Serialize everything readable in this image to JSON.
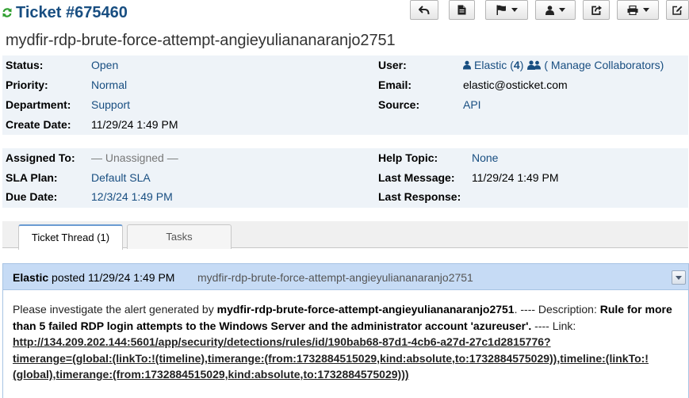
{
  "header": {
    "ticket_number": "Ticket #675460",
    "subject": "mydfir-rdp-brute-force-attempt-angieyuliananaranjo2751"
  },
  "toolbar": {
    "icons": [
      "reply-icon",
      "note-icon",
      "flag-icon",
      "user-icon",
      "share-icon",
      "print-icon",
      "edit-icon"
    ]
  },
  "info": {
    "status_label": "Status:",
    "status_value": "Open",
    "priority_label": "Priority:",
    "priority_value": "Normal",
    "department_label": "Department:",
    "department_value": "Support",
    "create_date_label": "Create Date:",
    "create_date_value": "11/29/24 1:49 PM",
    "user_label": "User:",
    "user_name": "Elastic",
    "user_count_open": "(",
    "user_count": "4",
    "user_count_close": ")",
    "manage_collaborators": "( Manage Collaborators)",
    "email_label": "Email:",
    "email_value": "elastic@osticket.com",
    "source_label": "Source:",
    "source_value": "API"
  },
  "info2": {
    "assigned_to_label": "Assigned To:",
    "assigned_to_value": "— Unassigned —",
    "sla_plan_label": "SLA Plan:",
    "sla_plan_value": "Default SLA",
    "due_date_label": "Due Date:",
    "due_date_value": "12/3/24 1:49 PM",
    "help_topic_label": "Help Topic:",
    "help_topic_value": "None",
    "last_message_label": "Last Message:",
    "last_message_value": "11/29/24 1:49 PM",
    "last_response_label": "Last Response:",
    "last_response_value": ""
  },
  "tabs": [
    {
      "label": "Ticket Thread (1)",
      "active": true
    },
    {
      "label": "Tasks",
      "active": false
    }
  ],
  "thread": {
    "poster_name": "Elastic",
    "posted_text": "posted 11/29/24 1:49 PM",
    "subject": "mydfir-rdp-brute-force-attempt-angieyuliananaranjo2751",
    "body_intro": "Please investigate the alert generated by ",
    "body_rule_name": "mydfir-rdp-brute-force-attempt-angieyuliananaranjo2751",
    "body_desc_prefix": ". ---- Description: ",
    "body_description": "Rule for more than 5 failed RDP login attempts to the Windows Server and the administrator account 'azureuser'.",
    "body_link_prefix": " ---- Link: ",
    "link_line1": "http://134.209.202.144:5601/app/security/detections/rules/id/190bab68-87d1-4cb6-a27d-27c1d2815776?",
    "link_line2": "timerange=(global:(linkTo:!(timeline),timerange:(from:1732884515029,kind:absolute,to:1732884575029)),timeline:(linkTo:!",
    "link_line3": "(global),timerange:(from:1732884515029,kind:absolute,to:1732884575029)))"
  },
  "colors": {
    "accent": "#184e81",
    "info_bg": "#eef3f8",
    "thread_header_bg": "#c6dbf5",
    "refresh_green": "#2e9e2e"
  }
}
